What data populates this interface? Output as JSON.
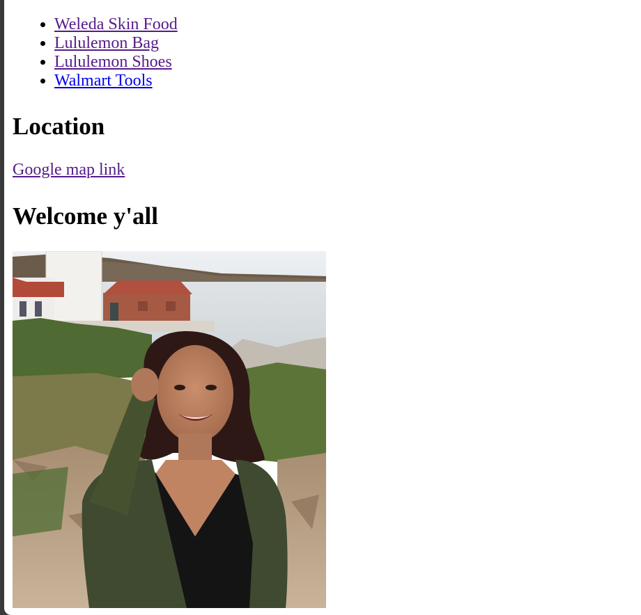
{
  "links": [
    {
      "label": "Weleda Skin Food",
      "state": "visited"
    },
    {
      "label": "Lululemon Bag",
      "state": "visited"
    },
    {
      "label": "Lululemon Shoes",
      "state": "visited"
    },
    {
      "label": "Walmart Tools",
      "state": "unvisited"
    }
  ],
  "location": {
    "heading": "Location",
    "map_link": "Google map link"
  },
  "welcome": {
    "heading": "Welcome y'all"
  },
  "colors": {
    "visited_link": "#551a8b",
    "unvisited_link": "#0000ee",
    "window_frame": "#3a3a3a"
  }
}
